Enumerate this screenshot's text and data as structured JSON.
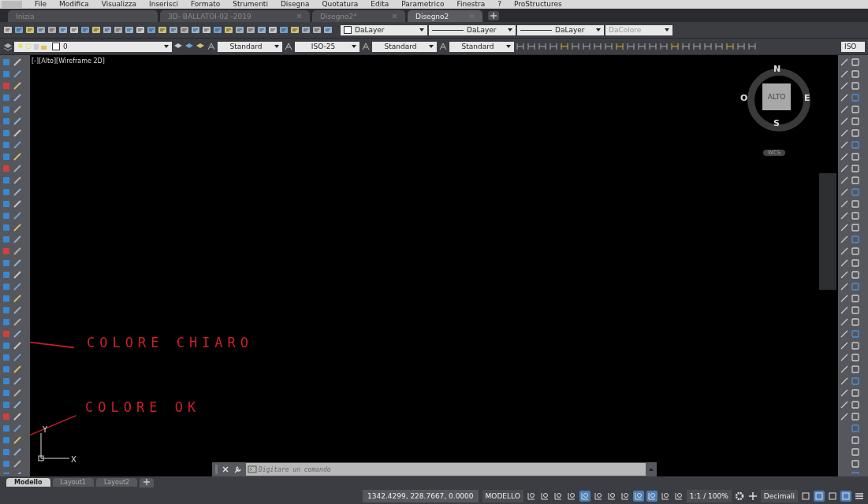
{
  "menu": [
    "File",
    "Modifica",
    "Visualizza",
    "Inserisci",
    "Formato",
    "Strumenti",
    "Disegna",
    "Quotatura",
    "Edita",
    "Parametrico",
    "Finestra",
    "?",
    "ProStructures"
  ],
  "tabs": [
    {
      "label": "Inizia",
      "selected": false,
      "closable": false
    },
    {
      "label": "3D- BALLATOI-02 -2019",
      "selected": false,
      "closable": true
    },
    {
      "label": "Disegno2*",
      "selected": false,
      "closable": true
    },
    {
      "label": "Disegno2",
      "selected": true,
      "closable": true
    }
  ],
  "properties": [
    {
      "kind": "color",
      "value": "DaLayer",
      "disabled": false
    },
    {
      "kind": "line",
      "value": "DaLayer",
      "disabled": false
    },
    {
      "kind": "line",
      "value": "DaLayer",
      "disabled": false
    },
    {
      "kind": "plain",
      "value": "DaColore",
      "disabled": true
    }
  ],
  "layer": {
    "value": "0"
  },
  "styles": [
    {
      "value": "Standard"
    },
    {
      "value": "ISO-25"
    },
    {
      "value": "Standard"
    },
    {
      "value": "Standard"
    }
  ],
  "cut_style": {
    "value": "ISO"
  },
  "viewport_label": "[-][Alto][Wireframe 2D]",
  "viewcube": {
    "north": "N",
    "east": "E",
    "south": "S",
    "west": "O",
    "face": "ALTO",
    "ucs": "WCS"
  },
  "annotations": [
    {
      "text": "COLORE CHIARO"
    },
    {
      "text": "COLORE OK"
    }
  ],
  "ucs_axes": {
    "y": "Y",
    "x": "X"
  },
  "command_line": {
    "placeholder": "Digitare un comando"
  },
  "layout_tabs": [
    {
      "label": "Modello",
      "selected": true
    },
    {
      "label": "Layout1",
      "selected": false
    },
    {
      "label": "Layout2",
      "selected": false
    }
  ],
  "status_bar": {
    "coordinates": "1342.4299, 228.7667, 0.0000",
    "space": "MODELLO",
    "scale": "1:1 / 100%",
    "units": "Decimali",
    "toggles": [
      {
        "on": false
      },
      {
        "on": false
      },
      {
        "on": false
      },
      {
        "on": false
      },
      {
        "on": true
      },
      {
        "on": false
      },
      {
        "on": false
      },
      {
        "on": false
      },
      {
        "on": true
      },
      {
        "on": true
      },
      {
        "on": false
      },
      {
        "on": false
      }
    ],
    "extra_toggles": [
      {
        "on": false
      },
      {
        "on": true
      },
      {
        "on": false
      },
      {
        "on": true
      }
    ]
  }
}
